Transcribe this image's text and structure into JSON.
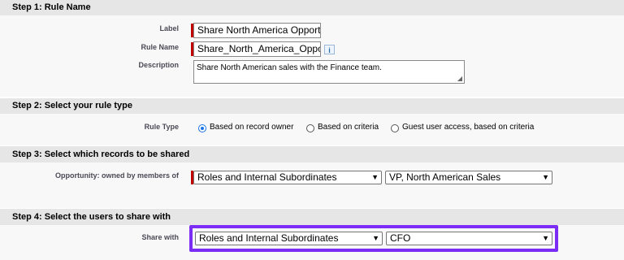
{
  "step1": {
    "heading": "Step 1: Rule Name",
    "label_caption": "Label",
    "label_value": "Share North America Opportunities",
    "rule_name_caption": "Rule Name",
    "rule_name_value": "Share_North_America_Opportunities",
    "info_icon": "i",
    "description_caption": "Description",
    "description_value": "Share North American sales with the Finance team."
  },
  "step2": {
    "heading": "Step 2: Select your rule type",
    "rule_type_caption": "Rule Type",
    "options": [
      {
        "label": "Based on record owner",
        "selected": true
      },
      {
        "label": "Based on criteria",
        "selected": false
      },
      {
        "label": "Guest user access, based on criteria",
        "selected": false
      }
    ]
  },
  "step3": {
    "heading": "Step 3: Select which records to be shared",
    "owned_caption": "Opportunity: owned by members of",
    "group_type": "Roles and Internal Subordinates",
    "group_value": "VP, North American Sales"
  },
  "step4": {
    "heading": "Step 4: Select the users to share with",
    "share_with_caption": "Share with",
    "group_type": "Roles and Internal Subordinates",
    "group_value": "CFO"
  },
  "colors": {
    "highlight": "#7b2cf5",
    "required": "#c00000"
  }
}
